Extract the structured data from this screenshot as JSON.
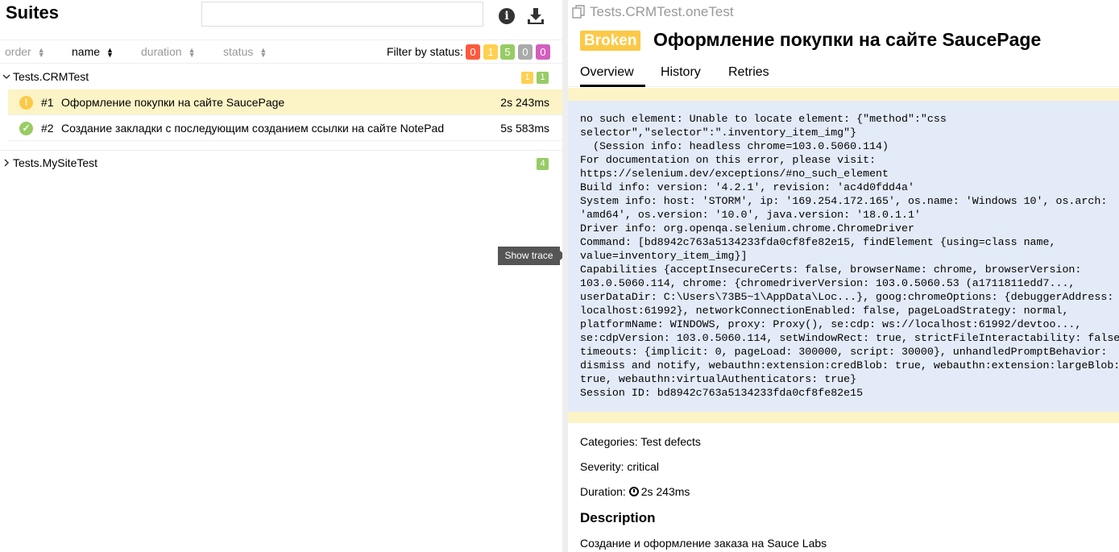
{
  "sidebar": {
    "title": "Suites",
    "search": {
      "value": "",
      "placeholder": ""
    },
    "info_icon": "info-icon",
    "download_icon": "download-icon",
    "sort": {
      "order": "order",
      "name": "name",
      "duration": "duration",
      "status": "status"
    },
    "filter": {
      "label": "Filter by status:",
      "badges": [
        {
          "count": "0",
          "color": "#fd5a3e"
        },
        {
          "count": "1",
          "color": "#ffd050"
        },
        {
          "count": "5",
          "color": "#97cc64"
        },
        {
          "count": "0",
          "color": "#aaaaaa"
        },
        {
          "count": "0",
          "color": "#d35ebe"
        }
      ]
    },
    "groups": [
      {
        "name": "Tests.CRMTest",
        "badges": [
          {
            "count": "1",
            "color": "#ffd050"
          },
          {
            "count": "1",
            "color": "#97cc64"
          }
        ],
        "tests": [
          {
            "num": "#1",
            "name": "Оформление покупки на сайте SaucePage",
            "duration": "2s 243ms",
            "status": "broken"
          },
          {
            "num": "#2",
            "name": "Создание закладки с последующим созданием ссылки на сайте NotePad",
            "duration": "5s 583ms",
            "status": "passed"
          }
        ]
      },
      {
        "name": "Tests.MySiteTest",
        "badges": [
          {
            "count": "4",
            "color": "#97cc64"
          }
        ]
      }
    ],
    "show_trace": "Show trace"
  },
  "detail": {
    "full_name": "Tests.CRMTest.oneTest",
    "status": "Broken",
    "title": "Оформление покупки на сайте SaucePage",
    "tabs": [
      "Overview",
      "History",
      "Retries"
    ],
    "error_message": "no such element: Unable to locate element: {\"method\":\"css\nselector\",\"selector\":\".inventory_item_img\"}\n  (Session info: headless chrome=103.0.5060.114)\nFor documentation on this error, please visit:\nhttps://selenium.dev/exceptions/#no_such_element\nBuild info: version: '4.2.1', revision: 'ac4d0fdd4a'\nSystem info: host: 'STORM', ip: '169.254.172.165', os.name: 'Windows 10', os.arch:\n'amd64', os.version: '10.0', java.version: '18.0.1.1'\nDriver info: org.openqa.selenium.chrome.ChromeDriver\nCommand: [bd8942c763a5134233fda0cf8fe82e15, findElement {using=class name,\nvalue=inventory_item_img}]\nCapabilities {acceptInsecureCerts: false, browserName: chrome, browserVersion:\n103.0.5060.114, chrome: {chromedriverVersion: 103.0.5060.53 (a1711811edd7...,\nuserDataDir: C:\\Users\\73B5~1\\AppData\\Loc...}, goog:chromeOptions: {debuggerAddress:\nlocalhost:61992}, networkConnectionEnabled: false, pageLoadStrategy: normal,\nplatformName: WINDOWS, proxy: Proxy(), se:cdp: ws://localhost:61992/devtoo...,\nse:cdpVersion: 103.0.5060.114, setWindowRect: true, strictFileInteractability: false,\ntimeouts: {implicit: 0, pageLoad: 300000, script: 30000}, unhandledPromptBehavior:\ndismiss and notify, webauthn:extension:credBlob: true, webauthn:extension:largeBlob:\ntrue, webauthn:virtualAuthenticators: true}\nSession ID: bd8942c763a5134233fda0cf8fe82e15",
    "categories": "Categories: Test defects",
    "severity": "Severity: critical",
    "duration_label": "Duration:",
    "duration_value": "2s 243ms",
    "description_heading": "Description",
    "description_text": "Создание и оформление заказа на Sauce Labs"
  }
}
